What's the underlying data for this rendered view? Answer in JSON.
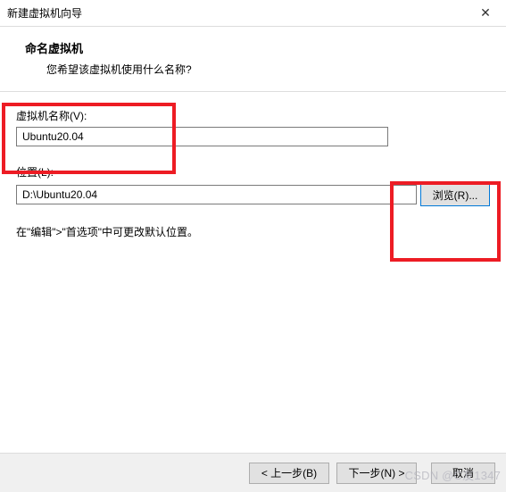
{
  "window": {
    "title": "新建虚拟机向导",
    "close_label": "✕"
  },
  "header": {
    "title": "命名虚拟机",
    "subtitle": "您希望该虚拟机使用什么名称?"
  },
  "fields": {
    "vm_name": {
      "label": "虚拟机名称(V):",
      "value": "Ubuntu20.04"
    },
    "location": {
      "label": "位置(L):",
      "value": "D:\\Ubuntu20.04",
      "browse_label": "浏览(R)..."
    }
  },
  "hint": "在\"编辑\">\"首选项\"中可更改默认位置。",
  "buttons": {
    "back": "< 上一步(B)",
    "next": "下一步(N) >",
    "cancel": "取消"
  },
  "watermark": "CSDN @C友1347"
}
